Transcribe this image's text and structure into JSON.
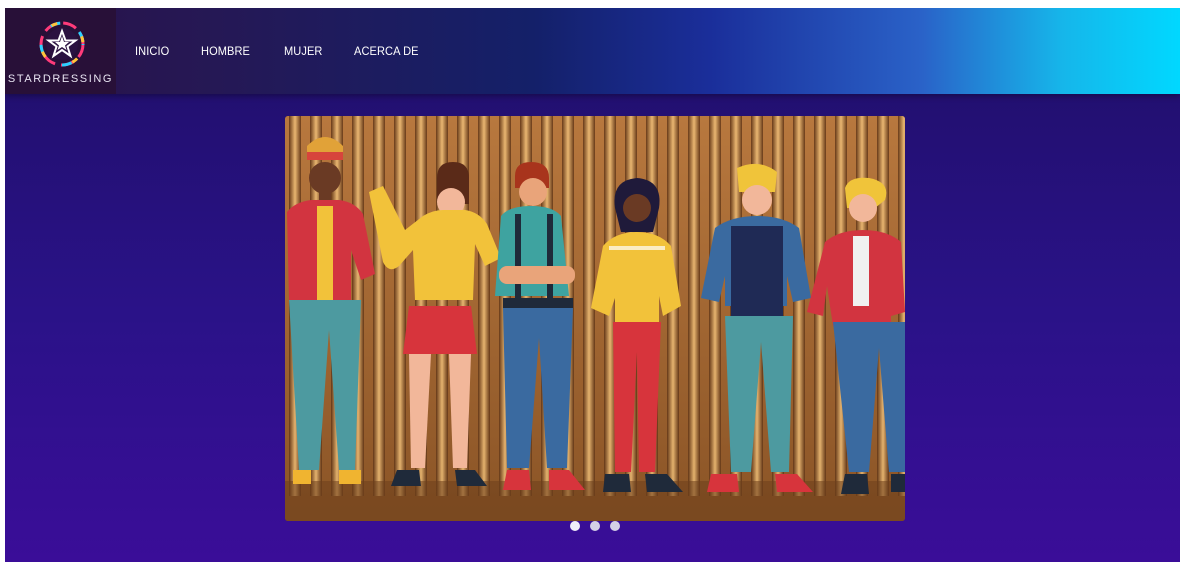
{
  "brand": {
    "name": "STARDRESSING",
    "logo_icon": "star-emblem-icon"
  },
  "nav": {
    "items": [
      {
        "label": "INICIO"
      },
      {
        "label": "HOMBRE"
      },
      {
        "label": "MUJER"
      },
      {
        "label": "ACERCA DE"
      }
    ]
  },
  "carousel": {
    "slide_count": 3,
    "active_slide": 1,
    "image_icon": "people-group-illustration-icon"
  },
  "colors": {
    "page_background": "#2a1288",
    "navbar_gradient_start": "#2a1248",
    "navbar_gradient_end": "#00d8ff",
    "slide_backdrop": "#c98a4a"
  }
}
